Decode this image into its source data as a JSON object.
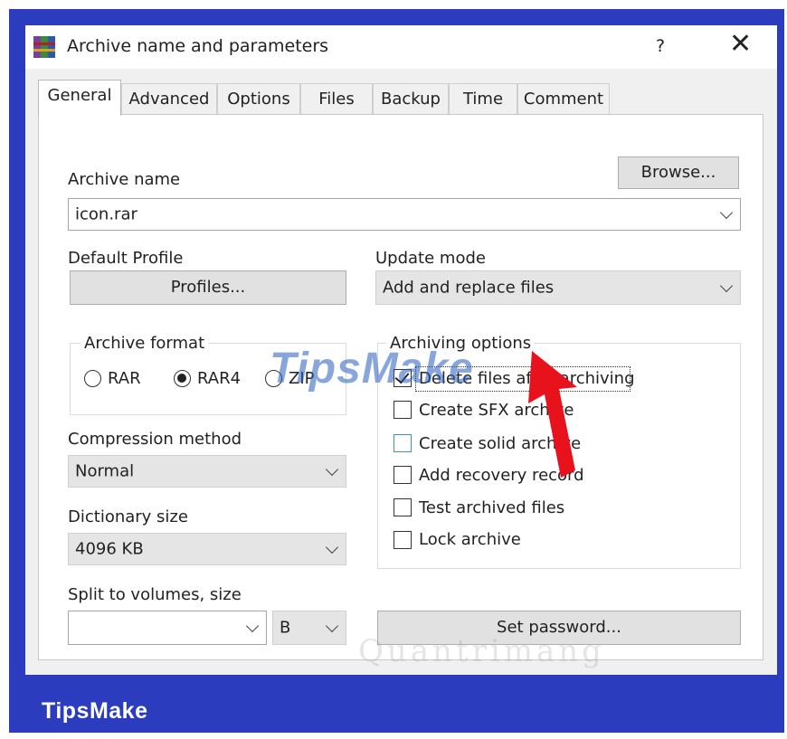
{
  "brand": "TipsMake",
  "window": {
    "title": "Archive name and parameters",
    "help_label": "?",
    "close_label": "✕"
  },
  "tabs": [
    {
      "label": "General"
    },
    {
      "label": "Advanced"
    },
    {
      "label": "Options"
    },
    {
      "label": "Files"
    },
    {
      "label": "Backup"
    },
    {
      "label": "Time"
    },
    {
      "label": "Comment"
    }
  ],
  "general": {
    "archive_name_label": "Archive name",
    "browse_label": "Browse...",
    "archive_name_value": "icon.rar",
    "default_profile_label": "Default Profile",
    "profiles_label": "Profiles...",
    "update_mode_label": "Update mode",
    "update_mode_value": "Add and replace files",
    "archive_format": {
      "legend": "Archive format",
      "options": [
        {
          "label": "RAR",
          "selected": false
        },
        {
          "label": "RAR4",
          "selected": true
        },
        {
          "label": "ZIP",
          "selected": false
        }
      ]
    },
    "compression_method_label": "Compression method",
    "compression_method_value": "Normal",
    "dictionary_size_label": "Dictionary size",
    "dictionary_size_value": "4096 KB",
    "split_label": "Split to volumes, size",
    "split_value": "",
    "split_unit": "B",
    "archiving_options": {
      "legend": "Archiving options",
      "items": [
        {
          "label": "Delete files after archiving",
          "checked": true
        },
        {
          "label": "Create SFX archive",
          "checked": false
        },
        {
          "label": "Create solid archive",
          "checked": false
        },
        {
          "label": "Add recovery record",
          "checked": false
        },
        {
          "label": "Test archived files",
          "checked": false
        },
        {
          "label": "Lock archive",
          "checked": false
        }
      ]
    },
    "set_password_label": "Set password..."
  },
  "watermarks": [
    "TipsMake",
    "Quantrimang"
  ],
  "colors": {
    "frame": "#2b3dbe",
    "arrow": "#e8121c",
    "checkbox_highlight": "#3d8fc4"
  }
}
